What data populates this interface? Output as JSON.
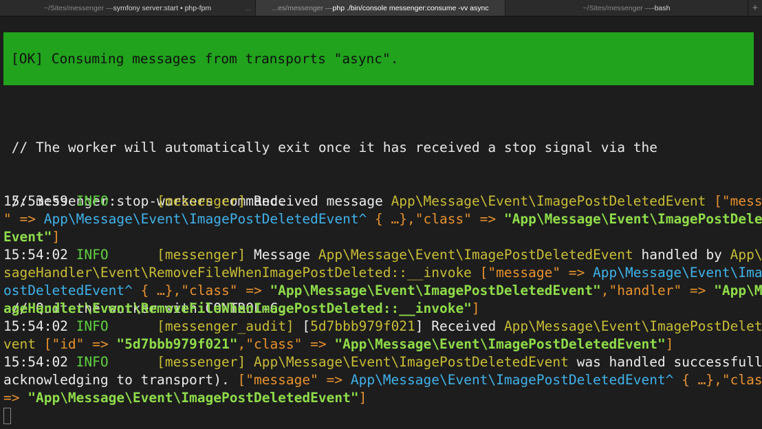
{
  "tabs": [
    {
      "dim": "~/Sites/messenger — ",
      "main": "symfony server:start • php-fpm",
      "active": false
    },
    {
      "dim": "...es/messenger — ",
      "main": "php ./bin/console messenger:consume -vv async",
      "active": true
    },
    {
      "dim": "~/Sites/messenger — ",
      "main": "-bash",
      "active": false
    }
  ],
  "tab_more": "...",
  "new_tab": "+",
  "banner": "[OK] Consuming messages from transports \"async\".",
  "comments": [
    " // The worker will automatically exit once it has received a stop signal via the",
    " // messenger:stop-workers command.",
    "",
    " // Quit the worker with CONTROL-C."
  ],
  "colors": {
    "white": "#ececec",
    "green": "#5fd33f",
    "yellow": "#c9bd35",
    "orange": "#e8922d",
    "cyan": "#3fb2ea",
    "strgreen": "#8fdc4a"
  },
  "log_lines": [
    [
      [
        "15:53:59 ",
        "white"
      ],
      [
        "INFO",
        "green"
      ],
      [
        "      ",
        "white"
      ],
      [
        "[messenger]",
        "yellow"
      ],
      [
        " Received message ",
        "white"
      ],
      [
        "App\\Message\\Event\\ImagePostDeletedEvent",
        "yellow"
      ],
      [
        " [\"message",
        "orange"
      ]
    ],
    [
      [
        "\" => ",
        "orange"
      ],
      [
        "App\\Message\\Event\\ImagePostDeletedEvent^",
        "cyan"
      ],
      [
        " { …},\"class\" => ",
        "orange"
      ],
      [
        "\"App\\Message\\Event\\ImagePostDeleted",
        "strgreen",
        true
      ]
    ],
    [
      [
        "Event\"",
        "strgreen",
        true
      ],
      [
        "]",
        "orange"
      ]
    ],
    [
      [
        "15:54:02 ",
        "white"
      ],
      [
        "INFO",
        "green"
      ],
      [
        "      ",
        "white"
      ],
      [
        "[messenger]",
        "yellow"
      ],
      [
        " Message ",
        "white"
      ],
      [
        "App\\Message\\Event\\ImagePostDeletedEvent",
        "yellow"
      ],
      [
        " handled by ",
        "white"
      ],
      [
        "App\\Mes",
        "yellow"
      ]
    ],
    [
      [
        "sageHandler\\Event\\RemoveFileWhenImagePostDeleted::__invoke",
        "yellow"
      ],
      [
        " [\"message\" => ",
        "orange"
      ],
      [
        "App\\Message\\Event\\ImageP",
        "cyan"
      ]
    ],
    [
      [
        "ostDeletedEvent^",
        "cyan"
      ],
      [
        " { …},\"class\" => ",
        "orange"
      ],
      [
        "\"App\\Message\\Event\\ImagePostDeletedEvent\"",
        "strgreen",
        true
      ],
      [
        ",\"handler\" => ",
        "orange"
      ],
      [
        "\"App\\Mess",
        "strgreen",
        true
      ]
    ],
    [
      [
        "ageHandler\\Event\\RemoveFileWhenImagePostDeleted::__invoke\"",
        "strgreen",
        true
      ],
      [
        "]",
        "orange"
      ]
    ],
    [
      [
        "15:54:02 ",
        "white"
      ],
      [
        "INFO",
        "green"
      ],
      [
        "      ",
        "white"
      ],
      [
        "[messenger_audit]",
        "yellow"
      ],
      [
        " [",
        "white"
      ],
      [
        "5d7bbb979f021",
        "yellow"
      ],
      [
        "] Received ",
        "white"
      ],
      [
        "App\\Message\\Event\\ImagePostDeletedE",
        "yellow"
      ]
    ],
    [
      [
        "vent",
        "yellow"
      ],
      [
        " [\"id\" => ",
        "orange"
      ],
      [
        "\"5d7bbb979f021\"",
        "strgreen",
        true
      ],
      [
        ",\"class\" => ",
        "orange"
      ],
      [
        "\"App\\Message\\Event\\ImagePostDeletedEvent\"",
        "strgreen",
        true
      ],
      [
        "]",
        "orange"
      ]
    ],
    [
      [
        "15:54:02 ",
        "white"
      ],
      [
        "INFO",
        "green"
      ],
      [
        "      ",
        "white"
      ],
      [
        "[messenger]",
        "yellow"
      ],
      [
        " App\\Message\\Event\\ImagePostDeletedEvent",
        "yellow"
      ],
      [
        " was handled successfully (",
        "white"
      ]
    ],
    [
      [
        "acknowledging to transport). ",
        "white"
      ],
      [
        "[\"message\" => ",
        "orange"
      ],
      [
        "App\\Message\\Event\\ImagePostDeletedEvent^",
        "cyan"
      ],
      [
        " { …},\"class\"",
        "orange"
      ]
    ],
    [
      [
        "=> ",
        "orange"
      ],
      [
        "\"App\\Message\\Event\\ImagePostDeletedEvent\"",
        "strgreen",
        true
      ],
      [
        "]",
        "orange"
      ]
    ]
  ]
}
